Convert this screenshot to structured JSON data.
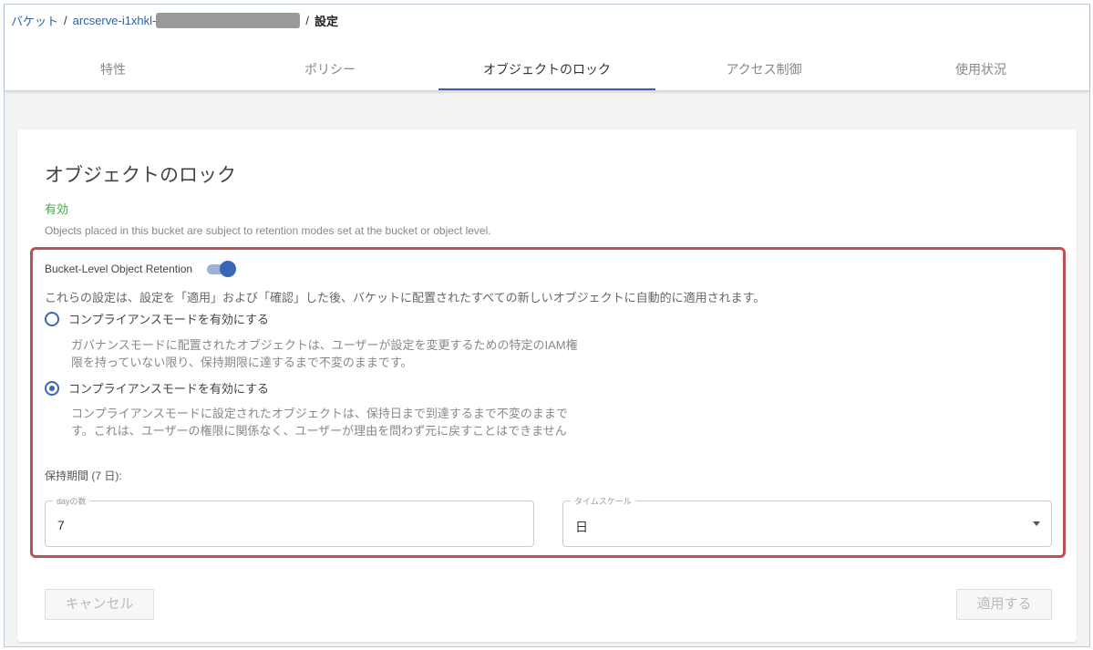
{
  "breadcrumb": {
    "root": "バケット",
    "bucket": "arcserve-i1xhkl-",
    "current": "設定",
    "sep": "/"
  },
  "tabs": [
    "特性",
    "ポリシー",
    "オブジェクトのロック",
    "アクセス制御",
    "使用状況"
  ],
  "active_tab": 2,
  "card": {
    "title": "オブジェクトのロック",
    "status": "有効",
    "description": "Objects placed in this bucket are subject to retention modes set at the bucket or object level.",
    "retention_label": "Bucket-Level Object Retention",
    "retention_enabled": true,
    "note": "これらの設定は、設定を「適用」および「確認」した後、バケットに配置されたすべての新しいオブジェクトに自動的に適用されます。",
    "options": [
      {
        "label": "コンプライアンスモードを有効にする",
        "selected": false,
        "desc": "ガバナンスモードに配置されたオブジェクトは、ユーザーが設定を変更するための特定のIAM権限を持っていない限り、保持期限に達するまで不変のままです。"
      },
      {
        "label": "コンプライアンスモードを有効にする",
        "selected": true,
        "desc": "コンプライアンスモードに設定されたオブジェクトは、保持日まで到達するまで不変のままです。これは、ユーザーの権限に関係なく、ユーザーが理由を問わず元に戻すことはできません"
      }
    ],
    "period_label": "保持期間 (7 日):",
    "days_label": "dayの数",
    "days_value": "7",
    "timescale_label": "タイムスケール",
    "timescale_value": "日",
    "cancel": "キャンセル",
    "apply": "適用する"
  }
}
